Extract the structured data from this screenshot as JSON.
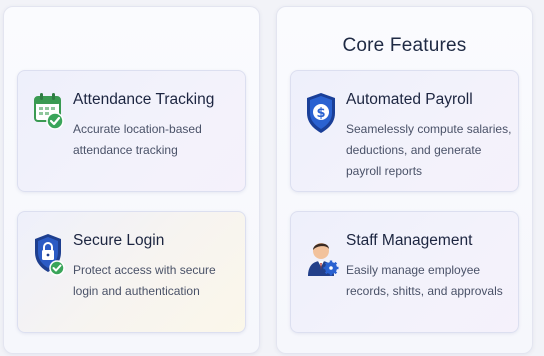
{
  "left_panel": {
    "cards": [
      {
        "title": "Attendance Tracking",
        "description": "Accurate location-based attendance tracking",
        "icon": "calendar-check-icon"
      },
      {
        "title": "Secure Login",
        "description": "Protect access with secure login and authentication",
        "icon": "shield-lock-icon"
      }
    ]
  },
  "right_panel": {
    "title": "Core Features",
    "cards": [
      {
        "title": "Automated Payroll",
        "description": "Seamelessly compute salaries, deductions, and generate payroll reports",
        "icon": "dollar-shield-icon"
      },
      {
        "title": "Staff Management",
        "description": "Easily manage employee records, shitts, and approvals",
        "icon": "employee-gear-icon"
      }
    ]
  },
  "colors": {
    "accent_blue": "#1f56c8",
    "check_green": "#3aa55a",
    "title_text": "#1c2540"
  }
}
